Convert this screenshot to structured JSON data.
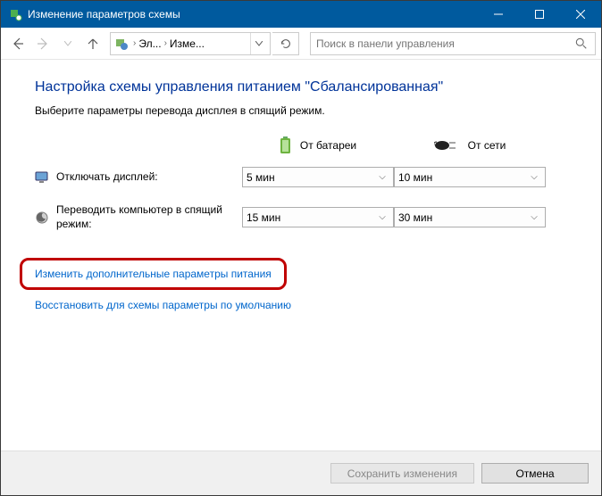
{
  "titlebar": {
    "title": "Изменение параметров схемы"
  },
  "nav": {
    "breadcrumb_root": "Эл...",
    "breadcrumb_leaf": "Изме...",
    "search_placeholder": "Поиск в панели управления"
  },
  "main": {
    "heading": "Настройка схемы управления питанием \"Сбалансированная\"",
    "description": "Выберите параметры перевода дисплея в спящий режим.",
    "col_battery": "От батареи",
    "col_ac": "От сети",
    "rows": [
      {
        "label": "Отключать дисплей:",
        "battery": "5 мин",
        "ac": "10 мин"
      },
      {
        "label": "Переводить компьютер в спящий режим:",
        "battery": "15 мин",
        "ac": "30 мин"
      }
    ],
    "link_advanced": "Изменить дополнительные параметры питания",
    "link_restore": "Восстановить для схемы параметры по умолчанию"
  },
  "footer": {
    "save": "Сохранить изменения",
    "cancel": "Отмена"
  }
}
